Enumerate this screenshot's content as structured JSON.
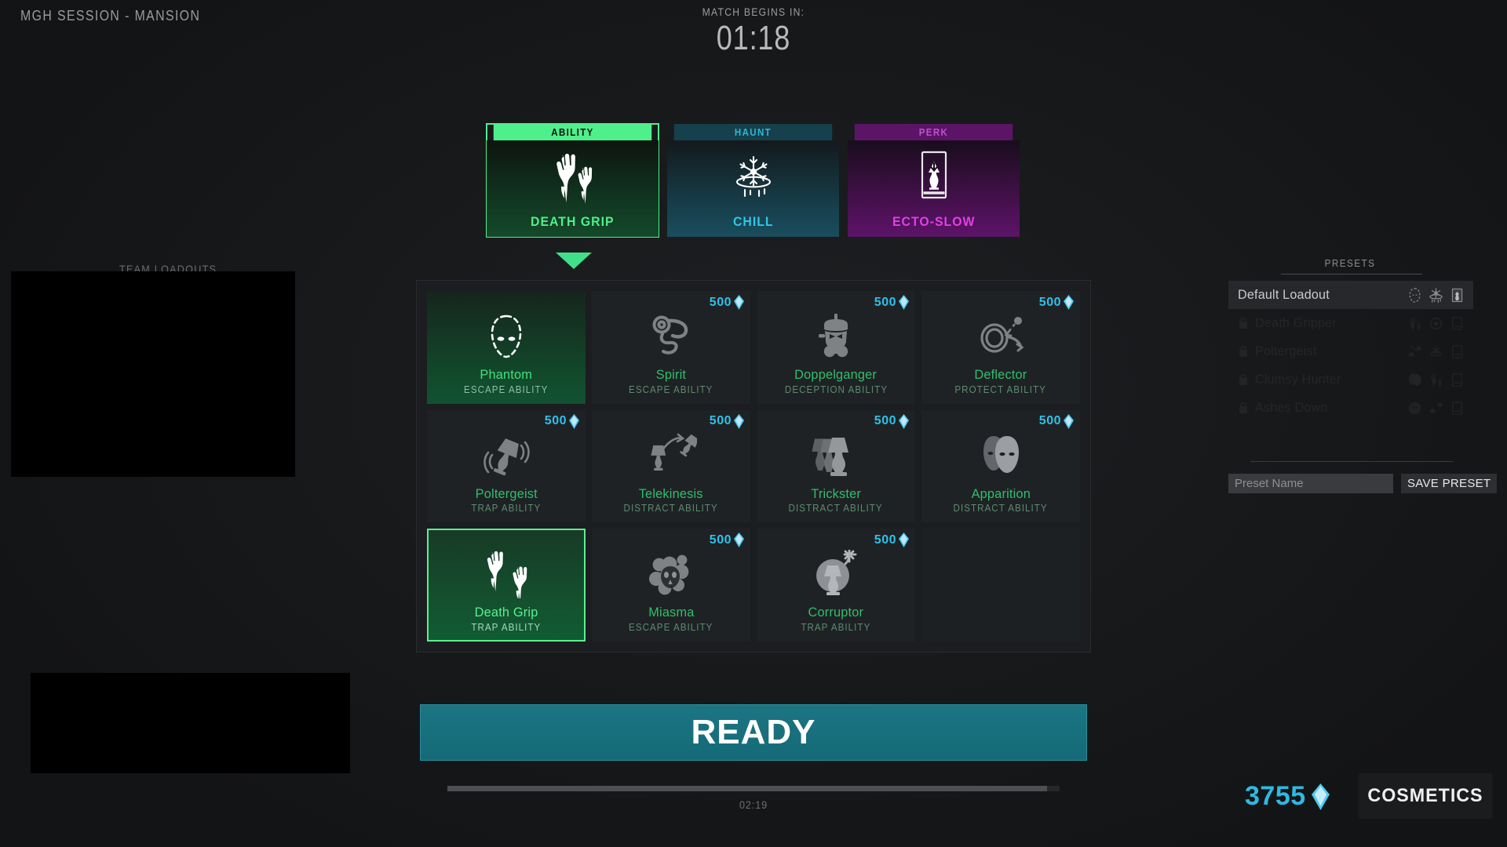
{
  "header": {
    "session_title": "MGH SESSION - MANSION",
    "match_begins_label": "MATCH BEGINS IN:",
    "match_timer": "01:18"
  },
  "left": {
    "team_loadouts_label": "TEAM LOADOUTS"
  },
  "slots": [
    {
      "category": "ABILITY",
      "name": "DEATH GRIP",
      "icon": "claw-hands-icon",
      "accent": "#4ef08c",
      "selected": true
    },
    {
      "category": "HAUNT",
      "name": "CHILL",
      "icon": "snowflake-ring-icon",
      "accent": "#2fc7e6",
      "selected": false
    },
    {
      "category": "PERK",
      "name": "ECTO-SLOW",
      "icon": "lamp-card-down-arrow-icon",
      "accent": "#e23fe2",
      "selected": false
    }
  ],
  "grid": {
    "cost_label": "500",
    "cells": [
      {
        "name": "Phantom",
        "type": "ESCAPE ABILITY",
        "icon": "dashed-mask-icon",
        "state": "owned",
        "cost": null
      },
      {
        "name": "Spirit",
        "type": "ESCAPE ABILITY",
        "icon": "gramophone-icon",
        "state": "locked",
        "cost": "500"
      },
      {
        "name": "Doppelganger",
        "type": "DECEPTION ABILITY",
        "icon": "gas-mask-icon",
        "state": "locked",
        "cost": "500"
      },
      {
        "name": "Deflector",
        "type": "PROTECT ABILITY",
        "icon": "ring-deflect-icon",
        "state": "locked",
        "cost": "500"
      },
      {
        "name": "Poltergeist",
        "type": "TRAP ABILITY",
        "icon": "shaking-lamp-icon",
        "state": "locked",
        "cost": "500"
      },
      {
        "name": "Telekinesis",
        "type": "DISTRACT ABILITY",
        "icon": "thrown-lamp-icon",
        "state": "locked",
        "cost": "500"
      },
      {
        "name": "Trickster",
        "type": "DISTRACT ABILITY",
        "icon": "triple-lamp-icon",
        "state": "locked",
        "cost": "500"
      },
      {
        "name": "Apparition",
        "type": "DISTRACT ABILITY",
        "icon": "double-face-icon",
        "state": "locked",
        "cost": "500"
      },
      {
        "name": "Death Grip",
        "type": "TRAP ABILITY",
        "icon": "claw-hands-icon",
        "state": "selected",
        "cost": null
      },
      {
        "name": "Miasma",
        "type": "ESCAPE ABILITY",
        "icon": "smoke-skull-icon",
        "state": "locked",
        "cost": "500"
      },
      {
        "name": "Corruptor",
        "type": "TRAP ABILITY",
        "icon": "lamp-bomb-icon",
        "state": "locked",
        "cost": "500"
      },
      {
        "name": "",
        "type": "",
        "icon": "",
        "state": "empty",
        "cost": null
      }
    ]
  },
  "ready": {
    "label": "READY",
    "timer": "02:19",
    "progress_percent": 98
  },
  "presets": {
    "title": "PRESETS",
    "rows": [
      {
        "name": "Default Loadout",
        "locked": false,
        "icons": [
          "dashed-mask-icon",
          "snowflake-ring-icon",
          "lamp-card-icon"
        ]
      },
      {
        "name": "Death Gripper",
        "locked": true,
        "icons": [
          "claw-hands-icon",
          "circle-target-icon",
          "card-icon"
        ]
      },
      {
        "name": "Poltergeist",
        "locked": true,
        "icons": [
          "thrown-lamp-icon",
          "snowflake-ring-icon",
          "card-icon"
        ]
      },
      {
        "name": "Clumsy Hunter",
        "locked": true,
        "icons": [
          "double-face-icon",
          "claw-hands-icon",
          "card-icon"
        ]
      },
      {
        "name": "Ashes Down",
        "locked": true,
        "icons": [
          "smoke-skull-icon",
          "thrown-lamp-icon",
          "card-icon"
        ]
      }
    ],
    "input_placeholder": "Preset Name",
    "input_value": "",
    "save_label": "SAVE PRESET"
  },
  "footer": {
    "currency_amount": "3755",
    "currency_icon": "gem-icon",
    "cosmetics_label": "COSMETICS"
  },
  "colors": {
    "ability_green": "#4ef08c",
    "haunt_teal": "#2fc7e6",
    "perk_purple": "#e23fe2",
    "gem_blue": "#2ec2ea",
    "ready_teal": "#18707d",
    "background": "#141517"
  }
}
